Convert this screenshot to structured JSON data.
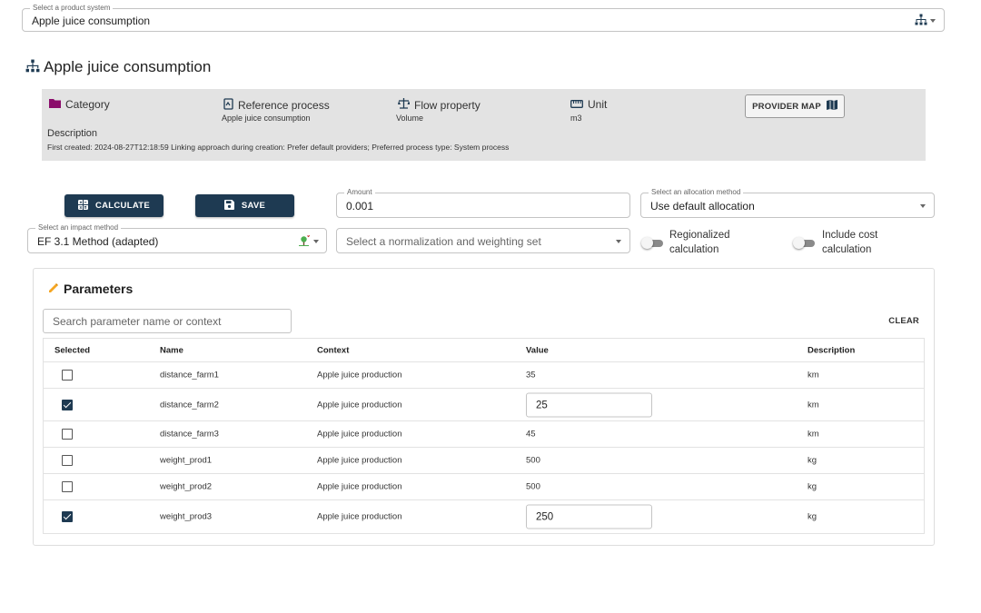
{
  "product_select": {
    "legend": "Select a product system",
    "value": "Apple juice consumption"
  },
  "title": "Apple juice consumption",
  "info": {
    "category_label": "Category",
    "reference_process_label": "Reference process",
    "reference_process_value": "Apple juice consumption",
    "flow_property_label": "Flow property",
    "flow_property_value": "Volume",
    "unit_label": "Unit",
    "unit_value": "m3",
    "provider_map_label": "PROVIDER MAP",
    "description_label": "Description",
    "description_text": "First created: 2024-08-27T12:18:59 Linking approach during creation: Prefer default providers; Preferred process type: System process"
  },
  "buttons": {
    "calculate": "CALCULATE",
    "save": "SAVE"
  },
  "amount": {
    "legend": "Amount",
    "value": "0.001"
  },
  "allocation": {
    "legend": "Select an allocation method",
    "value": "Use default allocation"
  },
  "impact": {
    "legend": "Select an impact method",
    "value": "EF 3.1 Method (adapted)"
  },
  "normalization": {
    "placeholder": "Select a normalization and weighting set"
  },
  "toggles": {
    "regionalized": {
      "label": "Regionalized calculation",
      "on": false
    },
    "include_cost": {
      "label": "Include cost calculation",
      "on": false
    }
  },
  "parameters": {
    "title": "Parameters",
    "search_placeholder": "Search parameter name or context",
    "clear_label": "CLEAR",
    "columns": {
      "selected": "Selected",
      "name": "Name",
      "context": "Context",
      "value": "Value",
      "description": "Description"
    },
    "rows": [
      {
        "selected": false,
        "name": "distance_farm1",
        "context": "Apple juice production",
        "value": "35",
        "description": "km"
      },
      {
        "selected": true,
        "name": "distance_farm2",
        "context": "Apple juice production",
        "value": "25",
        "description": "km"
      },
      {
        "selected": false,
        "name": "distance_farm3",
        "context": "Apple juice production",
        "value": "45",
        "description": "km"
      },
      {
        "selected": false,
        "name": "weight_prod1",
        "context": "Apple juice production",
        "value": "500",
        "description": "kg"
      },
      {
        "selected": false,
        "name": "weight_prod2",
        "context": "Apple juice production",
        "value": "500",
        "description": "kg"
      },
      {
        "selected": true,
        "name": "weight_prod3",
        "context": "Apple juice production",
        "value": "250",
        "description": "kg"
      }
    ]
  },
  "colors": {
    "primary": "#1e3a52",
    "panel": "#e3e3e3",
    "category_icon": "#8b0d6b",
    "icon_accent": "#1e3a52",
    "impact_icon": "#4caf50"
  }
}
